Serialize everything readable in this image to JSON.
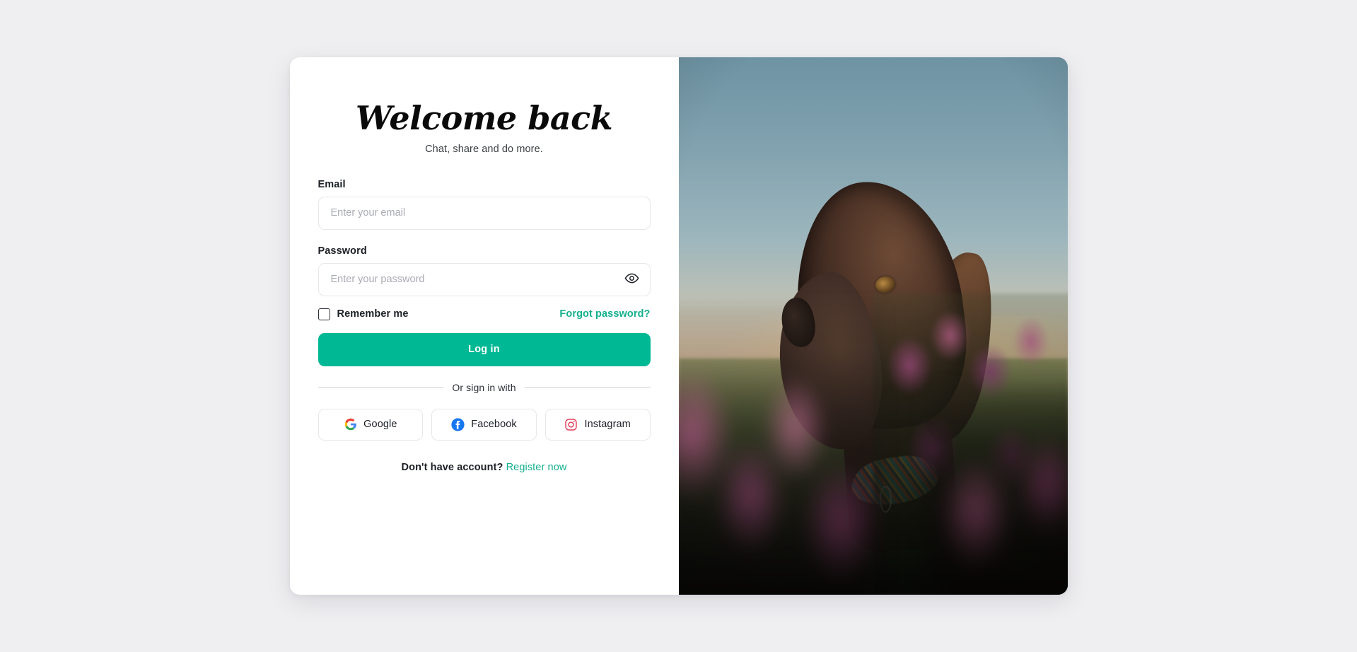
{
  "brand": {
    "accent_color": "#00b894",
    "link_color": "#13b08d",
    "page_background": "#efeff1",
    "card_background": "#ffffff"
  },
  "header": {
    "title": "Welcome back",
    "subtitle": "Chat, share and do more."
  },
  "form": {
    "email": {
      "label": "Email",
      "placeholder": "Enter your email",
      "value": ""
    },
    "password": {
      "label": "Password",
      "placeholder": "Enter your password",
      "value": "",
      "toggle_icon": "eye-icon"
    },
    "remember": {
      "label": "Remember me",
      "checked": false
    },
    "forgot_link": "Forgot password?",
    "submit_label": "Log in"
  },
  "divider": {
    "text": "Or sign in with"
  },
  "social": {
    "providers": [
      {
        "label": "Google",
        "icon": "google-icon",
        "color": "#4285f4"
      },
      {
        "label": "Facebook",
        "icon": "facebook-icon",
        "color": "#1877f2"
      },
      {
        "label": "Instagram",
        "icon": "instagram-icon",
        "color": "#e4405f"
      }
    ]
  },
  "register": {
    "prompt": "Don't have account?",
    "link": "Register now"
  },
  "photo": {
    "alt": "Chocolate labrador dog in a field of purple wildflowers at sunset"
  }
}
